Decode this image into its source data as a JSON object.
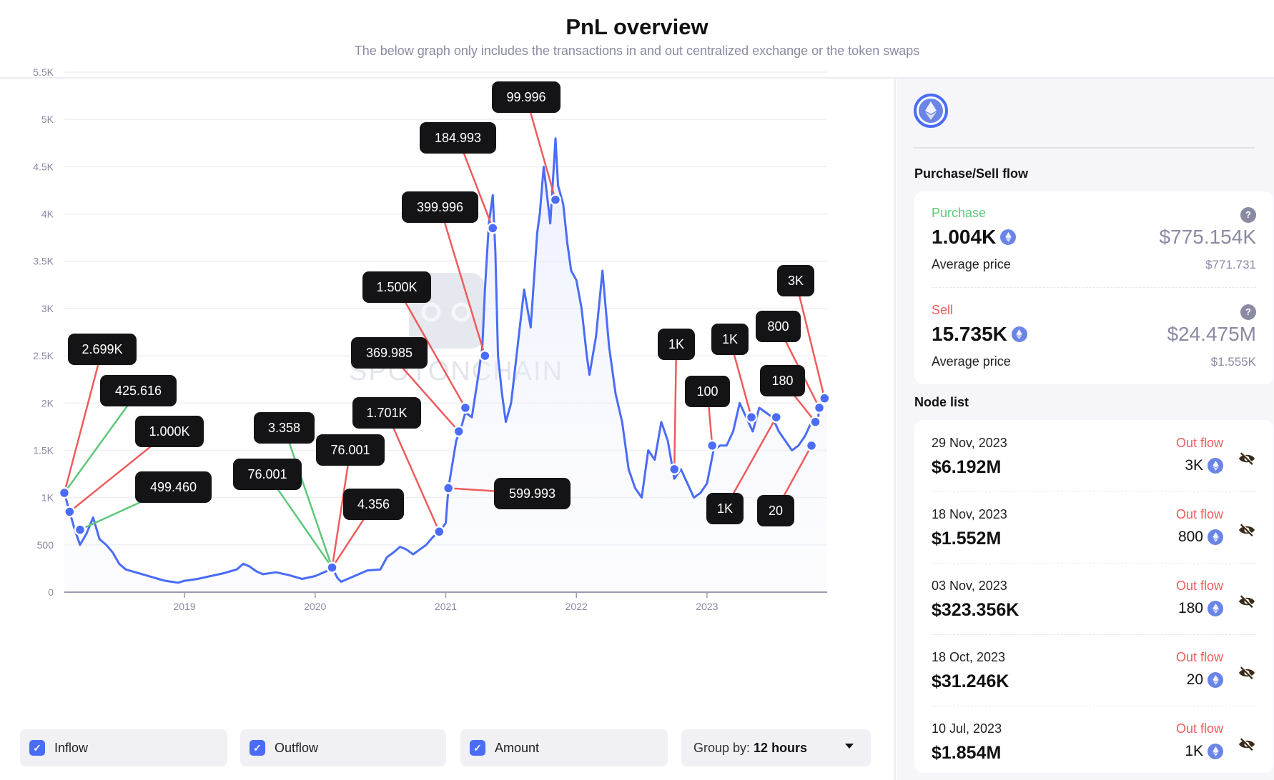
{
  "header": {
    "title": "PnL overview",
    "subtitle": "The below graph only includes the transactions in and out centralized exchange or the token swaps"
  },
  "chart_data": {
    "type": "line",
    "title": "PnL overview",
    "xlabel": "",
    "ylabel": "",
    "x_ticks": [
      "2019",
      "2020",
      "2021",
      "2022",
      "2023"
    ],
    "y_ticks": [
      "0",
      "500",
      "1K",
      "1.5K",
      "2K",
      "2.5K",
      "3K",
      "3.5K",
      "4K",
      "4.5K",
      "5K",
      "5.5K"
    ],
    "ylim": [
      0,
      5500
    ],
    "xlim": [
      2018.08,
      2023.92
    ],
    "grid": true,
    "watermark": "SPOTONCHAIN",
    "colors": {
      "line": "#4a6cf7",
      "inflow": "#5cc87a",
      "outflow": "#ef5b5b",
      "label_bg": "#141416"
    },
    "series": [
      {
        "name": "Amount",
        "x": [
          2018.08,
          2018.12,
          2018.16,
          2018.2,
          2018.25,
          2018.3,
          2018.35,
          2018.4,
          2018.45,
          2018.5,
          2018.55,
          2018.6,
          2018.65,
          2018.7,
          2018.75,
          2018.8,
          2018.85,
          2018.9,
          2018.95,
          2019.0,
          2019.1,
          2019.2,
          2019.3,
          2019.4,
          2019.45,
          2019.5,
          2019.55,
          2019.6,
          2019.7,
          2019.8,
          2019.9,
          2020.0,
          2020.1,
          2020.13,
          2020.17,
          2020.2,
          2020.3,
          2020.4,
          2020.5,
          2020.55,
          2020.6,
          2020.65,
          2020.7,
          2020.75,
          2020.8,
          2020.85,
          2020.9,
          2020.95,
          2021.0,
          2021.02,
          2021.05,
          2021.08,
          2021.12,
          2021.15,
          2021.2,
          2021.25,
          2021.28,
          2021.3,
          2021.33,
          2021.36,
          2021.38,
          2021.4,
          2021.43,
          2021.46,
          2021.5,
          2021.55,
          2021.6,
          2021.65,
          2021.7,
          2021.72,
          2021.75,
          2021.8,
          2021.84,
          2021.86,
          2021.88,
          2021.9,
          2021.93,
          2021.96,
          2022.0,
          2022.04,
          2022.08,
          2022.1,
          2022.15,
          2022.2,
          2022.25,
          2022.3,
          2022.35,
          2022.4,
          2022.45,
          2022.5,
          2022.55,
          2022.6,
          2022.65,
          2022.7,
          2022.75,
          2022.8,
          2022.85,
          2022.9,
          2022.95,
          2023.0,
          2023.05,
          2023.1,
          2023.15,
          2023.2,
          2023.25,
          2023.3,
          2023.35,
          2023.4,
          2023.45,
          2023.5,
          2023.55,
          2023.6,
          2023.65,
          2023.7,
          2023.75,
          2023.8,
          2023.85,
          2023.88,
          2023.92
        ],
        "values": [
          1050,
          850,
          660,
          500,
          620,
          790,
          560,
          500,
          420,
          300,
          240,
          220,
          200,
          180,
          160,
          140,
          120,
          110,
          100,
          120,
          140,
          170,
          200,
          240,
          300,
          270,
          220,
          190,
          210,
          180,
          140,
          170,
          230,
          260,
          150,
          110,
          170,
          230,
          240,
          370,
          420,
          480,
          450,
          400,
          450,
          500,
          580,
          640,
          730,
          1100,
          1350,
          1600,
          1750,
          1900,
          1850,
          2300,
          2600,
          3200,
          3900,
          4200,
          3600,
          2500,
          2100,
          1800,
          2000,
          2600,
          3200,
          2800,
          3800,
          4000,
          4500,
          3900,
          4800,
          4300,
          4200,
          4100,
          3700,
          3400,
          3300,
          3000,
          2500,
          2300,
          2700,
          3400,
          2600,
          2100,
          1800,
          1300,
          1100,
          1000,
          1500,
          1400,
          1800,
          1600,
          1200,
          1300,
          1150,
          1000,
          1050,
          1150,
          1500,
          1550,
          1550,
          1700,
          2000,
          1850,
          1700,
          1950,
          1900,
          1850,
          1700,
          1600,
          1500,
          1550,
          1650,
          1800,
          1850,
          2050,
          2050
        ]
      }
    ],
    "annotations": [
      {
        "label": "2.699K",
        "type": "outflow",
        "x": 2018.08,
        "y": 1050
      },
      {
        "label": "425.616",
        "type": "inflow",
        "x": 2018.08,
        "y": 1050
      },
      {
        "label": "1.000K",
        "type": "outflow",
        "x": 2018.12,
        "y": 850
      },
      {
        "label": "499.460",
        "type": "inflow",
        "x": 2018.2,
        "y": 660
      },
      {
        "label": "3.358",
        "type": "inflow",
        "x": 2020.13,
        "y": 260
      },
      {
        "label": "76.001",
        "type": "inflow",
        "x": 2020.13,
        "y": 260
      },
      {
        "label": "76.001",
        "type": "outflow",
        "x": 2020.13,
        "y": 260
      },
      {
        "label": "4.356",
        "type": "outflow",
        "x": 2020.13,
        "y": 260
      },
      {
        "label": "1.701K",
        "type": "outflow",
        "x": 2020.95,
        "y": 640
      },
      {
        "label": "599.993",
        "type": "outflow",
        "x": 2021.02,
        "y": 1100
      },
      {
        "label": "369.985",
        "type": "outflow",
        "x": 2021.1,
        "y": 1700
      },
      {
        "label": "1.500K",
        "type": "outflow",
        "x": 2021.15,
        "y": 1950
      },
      {
        "label": "399.996",
        "type": "outflow",
        "x": 2021.3,
        "y": 2500
      },
      {
        "label": "184.993",
        "type": "outflow",
        "x": 2021.36,
        "y": 3850
      },
      {
        "label": "99.996",
        "type": "outflow",
        "x": 2021.84,
        "y": 4150
      },
      {
        "label": "1K",
        "type": "outflow",
        "x": 2022.75,
        "y": 1300
      },
      {
        "label": "100",
        "type": "outflow",
        "x": 2023.04,
        "y": 1550
      },
      {
        "label": "1K",
        "type": "outflow",
        "x": 2023.34,
        "y": 1850
      },
      {
        "label": "1K",
        "type": "outflow",
        "x": 2023.53,
        "y": 1850
      },
      {
        "label": "180",
        "type": "outflow",
        "x": 2023.83,
        "y": 1800
      },
      {
        "label": "20",
        "type": "outflow",
        "x": 2023.8,
        "y": 1550
      },
      {
        "label": "800",
        "type": "outflow",
        "x": 2023.86,
        "y": 1950
      },
      {
        "label": "3K",
        "type": "outflow",
        "x": 2023.9,
        "y": 2050
      }
    ]
  },
  "controls": {
    "inflow": {
      "label": "Inflow",
      "checked": true
    },
    "outflow": {
      "label": "Outflow",
      "checked": true
    },
    "amount": {
      "label": "Amount",
      "checked": true
    },
    "group_by": {
      "prefix": "Group by: ",
      "value": "12 hours"
    }
  },
  "sidebar": {
    "token_icon": "ethereum-icon",
    "purchase_sell_title": "Purchase/Sell flow",
    "purchase": {
      "label": "Purchase",
      "amount": "1.004K",
      "usd": "$775.154K",
      "avg_label": "Average price",
      "avg_value": "$771.731",
      "color": "#5cc87a"
    },
    "sell": {
      "label": "Sell",
      "amount": "15.735K",
      "usd": "$24.475M",
      "avg_label": "Average price",
      "avg_value": "$1.555K",
      "color": "#ef5b5b"
    },
    "node_list_title": "Node list",
    "nodes": [
      {
        "date": "29 Nov, 2023",
        "usd": "$6.192M",
        "flow": "Out flow",
        "amount": "3K"
      },
      {
        "date": "18 Nov, 2023",
        "usd": "$1.552M",
        "flow": "Out flow",
        "amount": "800"
      },
      {
        "date": "03 Nov, 2023",
        "usd": "$323.356K",
        "flow": "Out flow",
        "amount": "180"
      },
      {
        "date": "18 Oct, 2023",
        "usd": "$31.246K",
        "flow": "Out flow",
        "amount": "20"
      },
      {
        "date": "10 Jul, 2023",
        "usd": "$1.854M",
        "flow": "Out flow",
        "amount": "1K"
      }
    ]
  }
}
